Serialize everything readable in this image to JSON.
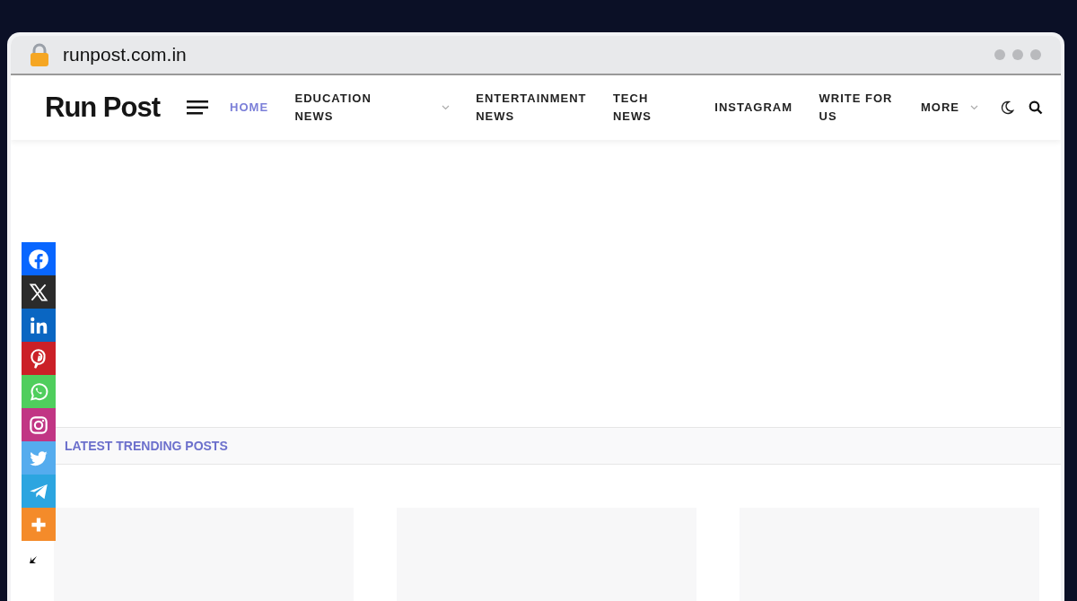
{
  "browser": {
    "url": "runpost.com.in"
  },
  "site": {
    "logo": "Run Post"
  },
  "nav": [
    {
      "label": "HOME",
      "selected": true,
      "dropdown": false
    },
    {
      "label": "EDUCATION NEWS",
      "selected": false,
      "dropdown": true
    },
    {
      "label": "ENTERTAINMENT NEWS",
      "selected": false,
      "dropdown": false
    },
    {
      "label": "TECH NEWS",
      "selected": false,
      "dropdown": false
    },
    {
      "label": "INSTAGRAM",
      "selected": false,
      "dropdown": false
    },
    {
      "label": "WRITE FOR US",
      "selected": false,
      "dropdown": false
    },
    {
      "label": "MORE",
      "selected": false,
      "dropdown": true
    }
  ],
  "share_bar": [
    {
      "kind": "facebook",
      "color": "#0866ff"
    },
    {
      "kind": "x",
      "color": "#2b2b2b"
    },
    {
      "kind": "linkedin",
      "color": "#0a66c2"
    },
    {
      "kind": "pinterest",
      "color": "#cb2027"
    },
    {
      "kind": "whatsapp",
      "color": "#4fce5d"
    },
    {
      "kind": "instagram",
      "color": "#c13584"
    },
    {
      "kind": "twitter",
      "color": "#55acee"
    },
    {
      "kind": "telegram",
      "color": "#2ca5e0"
    },
    {
      "kind": "more",
      "color": "#f48b2a"
    }
  ],
  "section": {
    "title": "LATEST TRENDING POSTS"
  },
  "posts": [
    {
      "kind": "placeholder"
    },
    {
      "kind": "placeholder"
    },
    {
      "kind": "placeholder"
    }
  ]
}
